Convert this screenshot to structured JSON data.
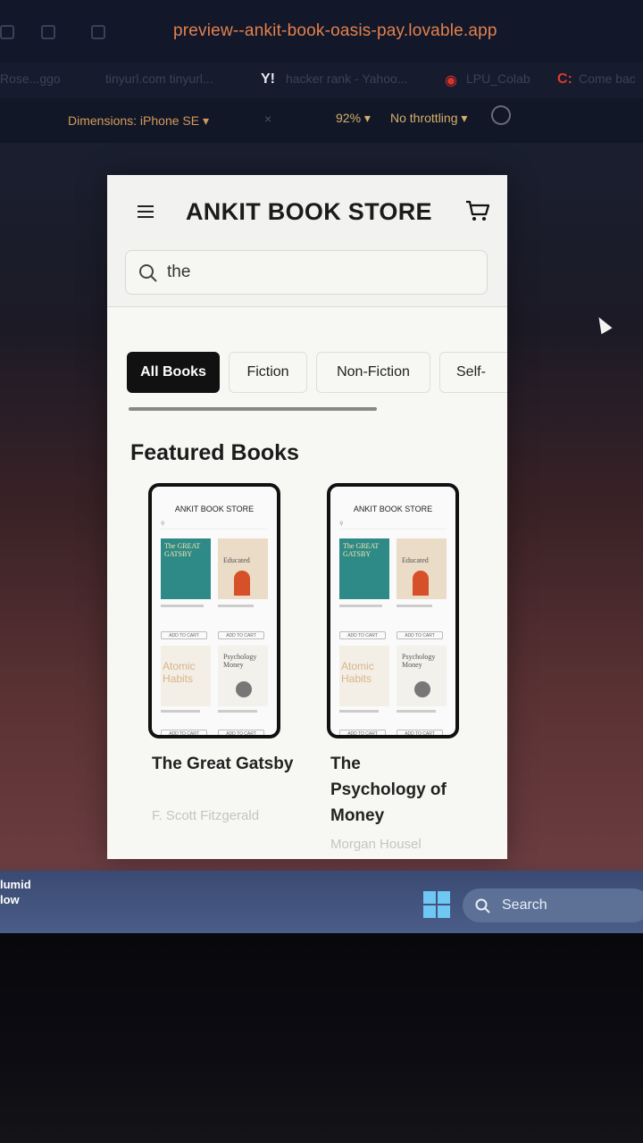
{
  "browser": {
    "url": "preview--ankit-book-oasis-pay.lovable.app",
    "bookmarks": [
      "Rose...ggo",
      "tinyurl.com tinyurl...",
      "hacker rank - Yahoo...",
      "LPU_Colab",
      "Come bac"
    ],
    "devtools": {
      "dimensions": "Dimensions: iPhone SE",
      "zoom": "92%",
      "throttling": "No throttling"
    }
  },
  "app": {
    "store_title": "ANKIT BOOK STORE",
    "search": {
      "value": "the"
    },
    "tabs": [
      {
        "label": "All Books",
        "active": true
      },
      {
        "label": "Fiction",
        "active": false
      },
      {
        "label": "Non-Fiction",
        "active": false
      },
      {
        "label": "Self-",
        "active": false
      }
    ],
    "section_title": "Featured Books",
    "books": [
      {
        "title": "The Great Gatsby",
        "author": "F. Scott Fitzgerald"
      },
      {
        "title": "The Psychology of Money",
        "author": "Morgan Housel"
      }
    ],
    "mini_screenshot": {
      "title": "ANKIT BOOK STORE",
      "covers": [
        "The GREAT GATSBY",
        "Educated",
        "Atomic Habits",
        "Psychology Money"
      ],
      "cover_labels": [
        "The Great Gatsby",
        "Educated",
        "Atomic Habits",
        "The Psychology of Money"
      ],
      "prices": [
        "₹299",
        "₹399",
        "₹450",
        "₹475"
      ],
      "button": "ADD TO CART"
    }
  },
  "taskbar": {
    "weather_line1": "lumid",
    "weather_line2": "low",
    "search_label": "Search"
  },
  "colors": {
    "url": "#e2814d",
    "active_tab": "#111111",
    "gatsby_cover": "#2e8a86",
    "educated_accent": "#d6502a",
    "atomic_text": "#d8b48a",
    "taskbar": "#4a5d88"
  }
}
